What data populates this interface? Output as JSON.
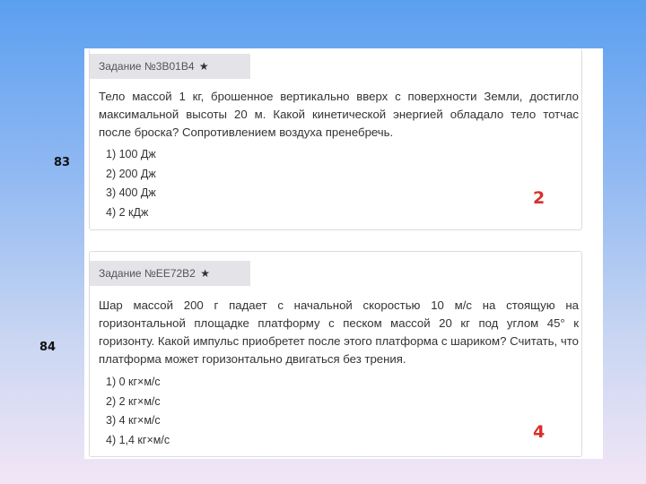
{
  "side_numbers": [
    "83",
    "84"
  ],
  "tasks": [
    {
      "tag": "Задание №3B01B4",
      "text": "Тело массой 1 кг, брошенное вертикально вверх с поверхности Земли, достигло максимальной высоты 20 м. Какой кинетической энергией обладало тело тотчас после броска? Сопротивлением воздуха пренебречь.",
      "options": [
        "1) 100 Дж",
        "2) 200 Дж",
        "3) 400 Дж",
        "4) 2 кДж"
      ],
      "answer": "2"
    },
    {
      "tag": "Задание №EE72B2",
      "text": "Шар массой 200 г падает с начальной скоростью 10 м/с на стоящую на горизонтальной площадке платформу с песком массой 20 кг под углом 45° к горизонту. Какой импульс приобретет после этого платформа с шариком? Считать, что платформа может горизонтально двигаться без трения.",
      "options": [
        "1) 0 кг×м/с",
        "2) 2 кг×м/с",
        "3) 4 кг×м/с",
        "4) 1,4 кг×м/с"
      ],
      "answer": "4"
    }
  ],
  "icons": {
    "favorite": "star-icon"
  }
}
